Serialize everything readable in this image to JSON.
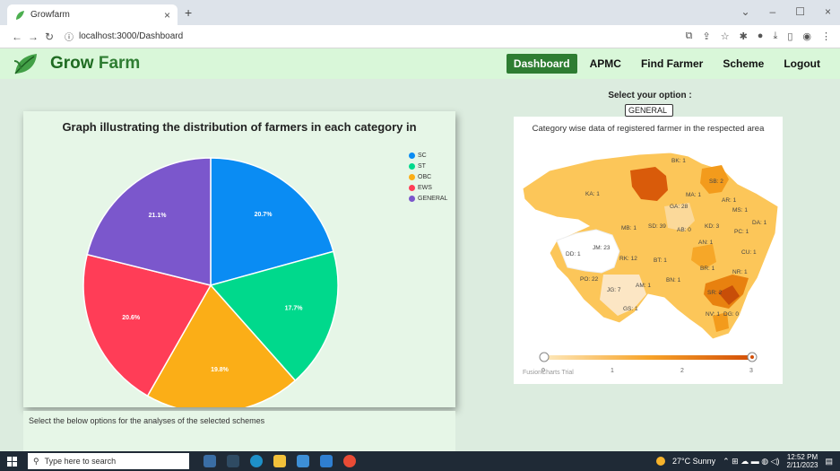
{
  "browser": {
    "tab_title": "Growfarm",
    "tab_close": "×",
    "new_tab": "+",
    "url": "localhost:3000/Dashboard",
    "win_minimize": "–",
    "win_maximize": "☐",
    "win_close": "×",
    "chevron": "⌄"
  },
  "header": {
    "brand_first": "Grow ",
    "brand_second": "Farm",
    "menu": [
      "Dashboard",
      "APMC",
      "Find Farmer",
      "Scheme",
      "Logout"
    ],
    "active": "Dashboard"
  },
  "pie_section": {
    "title": "Graph illustrating the distribution of farmers in each category in",
    "footer_text": "Select the below options for the analyses of the selected schemes"
  },
  "chart_data": {
    "type": "pie",
    "title": "Graph illustrating the distribution of farmers in each category in",
    "categories": [
      "SC",
      "ST",
      "OBC",
      "EWS",
      "GENERAL"
    ],
    "values": [
      20.7,
      17.7,
      19.8,
      20.6,
      21.1
    ],
    "labels": [
      "20.7%",
      "17.7%",
      "19.8%",
      "20.6%",
      "21.1%"
    ],
    "colors": [
      "#0a8cf3",
      "#00d98c",
      "#fbae17",
      "#ff3d57",
      "#7b57cc"
    ],
    "legend_placement": "top-right"
  },
  "map_section": {
    "select_label": "Select your option :",
    "selected_value": "GENERAL",
    "title": "Category wise data of registered farmer in the respected area",
    "slider_ticks": [
      "0",
      "1",
      "2",
      "3"
    ],
    "watermark": "FusionCharts Trial",
    "regions": [
      "BK: 1",
      "KA: 1",
      "SB: 2",
      "MA: 1",
      "AR: 1",
      "GA: 28",
      "MS: 1",
      "DA: 1",
      "MB: 1",
      "SD: 39",
      "AB: 0",
      "KD: 3",
      "PC: 1",
      "AN: 1",
      "JM: 23",
      "CU: 1",
      "DD: 1",
      "RK: 12",
      "BT: 1",
      "BR: 1",
      "NR: 1",
      "PO: 22",
      "BN: 1",
      "AM: 1",
      "JG: 7",
      "SR: 2",
      "GS: 1",
      "NV: 1",
      "DG: 0"
    ]
  },
  "taskbar": {
    "search_placeholder": "Type here to search",
    "weather": "27°C  Sunny",
    "time": "12:52 PM",
    "date": "2/11/2023"
  },
  "colors": {
    "accent": "#2e7d32",
    "brand": "#1f6b22",
    "nav_bg": "#d9f7d9",
    "page_bg": "#dcecdf"
  }
}
